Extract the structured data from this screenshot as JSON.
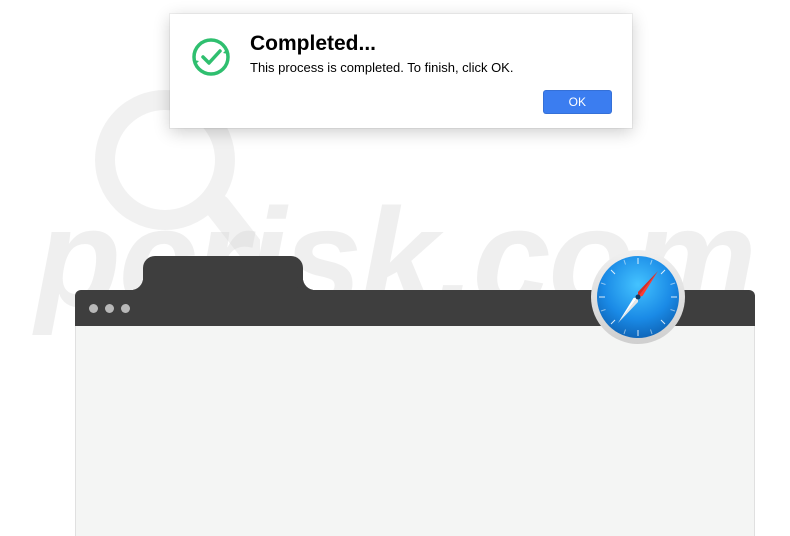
{
  "dialog": {
    "title": "Completed...",
    "message": "This process is completed. To finish, click OK.",
    "ok_label": "OK",
    "icon_name": "checkmark-circle-icon"
  },
  "browser": {
    "safari_icon_name": "safari-icon"
  },
  "watermark": {
    "text": "pcrisk.com",
    "icon_name": "magnifier-icon"
  },
  "colors": {
    "accent_blue": "#3b7df0",
    "success_green": "#2fbf6f",
    "titlebar_dark": "#3e3e3e",
    "content_gray": "#f4f5f4"
  }
}
